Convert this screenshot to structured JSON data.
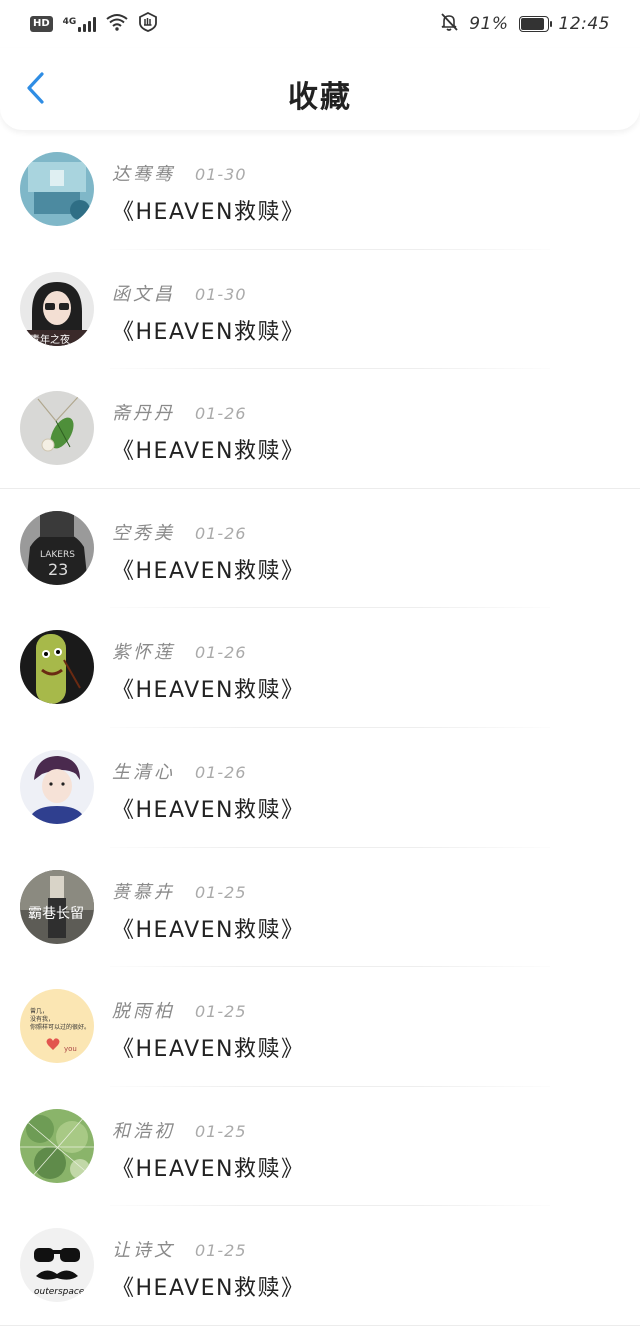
{
  "status_bar": {
    "hd": "HD",
    "network": "4G",
    "battery_percent": "91%",
    "battery_level": 0.91,
    "time": "12:45"
  },
  "header": {
    "title": "收藏",
    "back_icon": "chevron-left-icon",
    "accent_color": "#2f8de4"
  },
  "favorites": [
    {
      "name": "达骞骞",
      "date": "01-30",
      "title": "《HEAVEN救赎》",
      "avatar": "blue-scene"
    },
    {
      "name": "函文昌",
      "date": "01-30",
      "title": "《HEAVEN救赎》",
      "avatar": "girl-glasses"
    },
    {
      "name": "斋丹丹",
      "date": "01-26",
      "title": "《HEAVEN救赎》",
      "avatar": "leaf-pendant"
    },
    {
      "name": "空秀美",
      "date": "01-26",
      "title": "《HEAVEN救赎》",
      "avatar": "jersey"
    },
    {
      "name": "紫怀莲",
      "date": "01-26",
      "title": "《HEAVEN救赎》",
      "avatar": "cucumber-face"
    },
    {
      "name": "生清心",
      "date": "01-26",
      "title": "《HEAVEN救赎》",
      "avatar": "boy-portrait"
    },
    {
      "name": "蒉慕卉",
      "date": "01-25",
      "title": "《HEAVEN救赎》",
      "avatar": "text-photo"
    },
    {
      "name": "脱雨柏",
      "date": "01-25",
      "title": "《HEAVEN救赎》",
      "avatar": "note-card"
    },
    {
      "name": "和浩初",
      "date": "01-25",
      "title": "《HEAVEN救赎》",
      "avatar": "cactus"
    },
    {
      "name": "让诗文",
      "date": "01-25",
      "title": "《HEAVEN救赎》",
      "avatar": "mustache"
    }
  ]
}
